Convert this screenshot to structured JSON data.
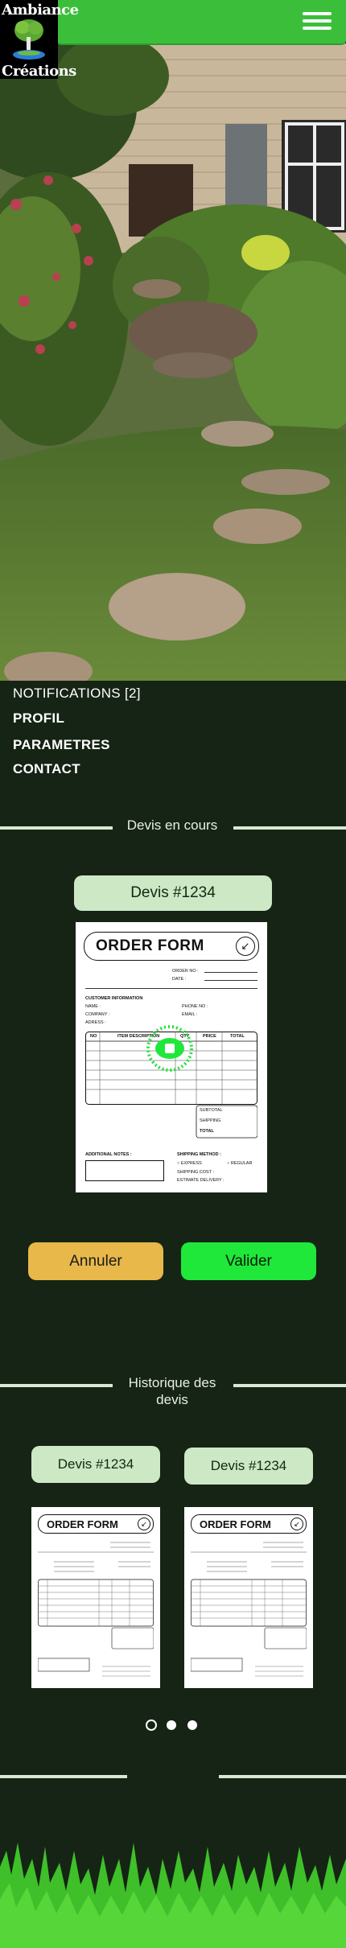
{
  "brand": {
    "line1": "Ambiance",
    "line2": "Créations"
  },
  "menu": {
    "notifications": "NOTIFICATIONS [2]",
    "profil": "PROFIL",
    "parametres": "PARAMETRES",
    "contact": "CONTACT"
  },
  "current_quotes": {
    "title": "Devis en cours",
    "quote_label": "Devis #1234",
    "cancel": "Annuler",
    "validate": "Valider"
  },
  "history": {
    "title_line1": "Historique des",
    "title_line2": "devis",
    "quotes": [
      {
        "label": "Devis #1234"
      },
      {
        "label": "Devis #1234"
      }
    ],
    "pager": {
      "count": 3,
      "active": 0
    }
  },
  "order_form": {
    "title": "ORDER FORM",
    "order_no": "ORDER NO :",
    "date": "DATE :",
    "customer_info": "CUSTOMER INFORMATION",
    "name": "NAME :",
    "company": "COMPANY :",
    "adress": "ADRESS :",
    "phone": "PHONE NO :",
    "email": "EMAIL :",
    "col_no": "NO",
    "col_desc": "ITEM DESCRIPTION",
    "col_qty": "QTY",
    "col_price": "PRICE",
    "col_total": "TOTAL",
    "subtotal": "SUBTOTAL",
    "shipping": "SHIPPING",
    "total": "TOTAL",
    "notes": "ADDITIONAL NOTES :",
    "shipping_method": "SHIPPING METHOD :",
    "express": "EXPRESS",
    "regular": "REGULAR",
    "shipping_cost": "SHIPPING COST :",
    "estimate": "ESTIMATE DELIVERY :"
  },
  "colors": {
    "background": "#152414",
    "accent": "#3bbf3b",
    "pill": "#cde8c5",
    "cancel": "#e8b84b",
    "validate": "#1fe83a"
  }
}
